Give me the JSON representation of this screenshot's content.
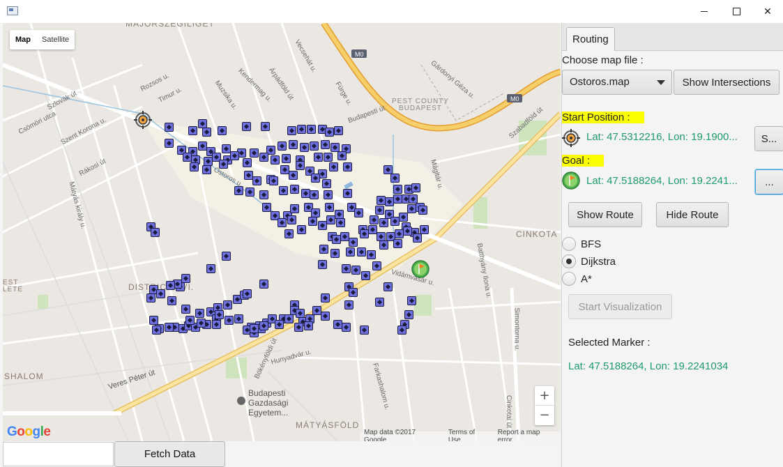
{
  "window": {
    "icon": "app-window-icon",
    "controls": [
      "minimize-icon",
      "maximize-icon",
      "close-icon"
    ]
  },
  "map": {
    "type_control": {
      "map_label": "Map",
      "satellite_label": "Satellite",
      "selected": "Map"
    },
    "street_labels": [
      {
        "text": "MAJORSZEGILIGET"
      },
      {
        "text": "Szlovák út"
      },
      {
        "text": "Csömöri utca"
      },
      {
        "text": "Szent Korona u."
      },
      {
        "text": "Mátyás király u."
      },
      {
        "text": "Rákosi út"
      },
      {
        "text": "Timur u."
      },
      {
        "text": "Rozsos u."
      },
      {
        "text": "Muzsika u."
      },
      {
        "text": "Árpádföld út"
      },
      {
        "text": "Kendermag u."
      },
      {
        "text": "Vecsehát u."
      },
      {
        "text": "Fürge u."
      },
      {
        "text": "Budapesti út"
      },
      {
        "text": "Ostoros u."
      },
      {
        "text": "Szabadföld út"
      },
      {
        "text": "Vidámvásár u."
      },
      {
        "text": "Bökényföldi út"
      },
      {
        "text": "Hunyadvár u."
      },
      {
        "text": "Veres Péter út"
      },
      {
        "text": "Farkashalom u."
      },
      {
        "text": "Simontorna u."
      },
      {
        "text": "Cinkotai út"
      },
      {
        "text": "Batthyány Ilona u."
      },
      {
        "text": "Mágltár u."
      },
      {
        "text": "Gárdonyi Géza u."
      }
    ],
    "area_labels": [
      {
        "text": "PEST COUNTY\nBUDAPEST"
      },
      {
        "text": "CINKOTA"
      },
      {
        "text": "DISTRICT XVI."
      },
      {
        "text": "SHALOM"
      },
      {
        "text": "MÁTYÁSFÖLD"
      },
      {
        "text": "EST\nLETE"
      }
    ],
    "poi_label": "Budapesti Gazdasági Egyetem...",
    "highway_labels": [
      "M0",
      "M0"
    ],
    "google_logo": "Google",
    "attribution": {
      "data": "Map data ©2017 Google",
      "terms": "Terms of Use",
      "report": "Report a map error"
    },
    "zoom_in": "+",
    "zoom_out": "−",
    "start_marker_icon": "target-crosshair-icon",
    "goal_marker_icon": "flag-icon"
  },
  "bottom_bar": {
    "input_value": "",
    "fetch_label": "Fetch Data"
  },
  "panel": {
    "tab_label": "Routing",
    "choose_map_label": "Choose map file :",
    "map_select_value": "Ostoros.map",
    "show_intersections_label": "Show Intersections",
    "start_position_label": "Start Position :",
    "start_coord": "Lat: 47.5312216, Lon: 19.1900...",
    "start_button_label": "S...",
    "goal_label": "Goal :",
    "goal_coord": "Lat: 47.5188264, Lon: 19.2241...",
    "goal_button_label": "...",
    "show_route_label": "Show Route",
    "hide_route_label": "Hide Route",
    "algorithms": [
      {
        "label": "BFS",
        "checked": false
      },
      {
        "label": "Dijkstra",
        "checked": true
      },
      {
        "label": "A*",
        "checked": false
      }
    ],
    "start_visualization_label": "Start Visualization",
    "selected_marker_label": "Selected Marker :",
    "selected_marker_coord": "Lat: 47.5188264, Lon: 19.2241034",
    "colors": {
      "highlight": "#fbff00",
      "coord_text": "#1f9a6a",
      "marker_fill": "#6e70e0",
      "road_major": "#f6cf6a",
      "road_highway": "#f0a23a"
    }
  }
}
